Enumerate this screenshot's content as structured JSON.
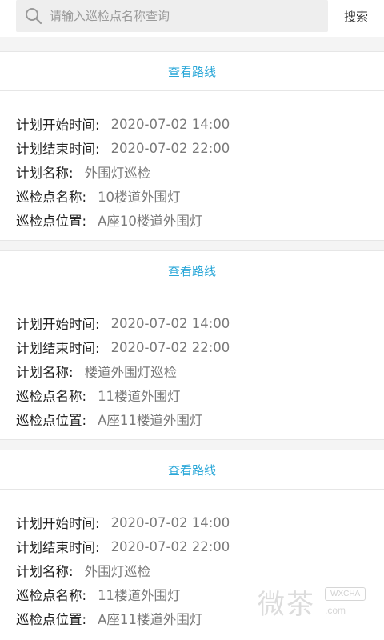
{
  "search": {
    "placeholder": "请输入巡检点名称查询",
    "button_label": "搜索"
  },
  "route_link_label": "查看路线",
  "labels": {
    "start": "计划开始时间:",
    "end": "计划结束时间:",
    "plan_name": "计划名称:",
    "point_name": "巡检点名称:",
    "point_location": "巡检点位置:"
  },
  "records": [
    {
      "start": "2020-07-02 14:00",
      "end": "2020-07-02 22:00",
      "plan_name": "外围灯巡检",
      "point_name": "10楼道外围灯",
      "point_location": "A座10楼道外围灯"
    },
    {
      "start": "2020-07-02 14:00",
      "end": "2020-07-02 22:00",
      "plan_name": "楼道外围灯巡检",
      "point_name": "11楼道外围灯",
      "point_location": "A座11楼道外围灯"
    },
    {
      "start": "2020-07-02 14:00",
      "end": "2020-07-02 22:00",
      "plan_name": "外围灯巡检",
      "point_name": "11楼道外围灯",
      "point_location": "A座11楼道外围灯"
    }
  ],
  "watermark": {
    "text": "微茶",
    "badge": "WXCHA",
    "domain": ".com"
  },
  "colors": {
    "link": "#2aa7d8",
    "search_bg": "#eeeeee",
    "label": "#222222",
    "value": "#7a7a7a"
  }
}
